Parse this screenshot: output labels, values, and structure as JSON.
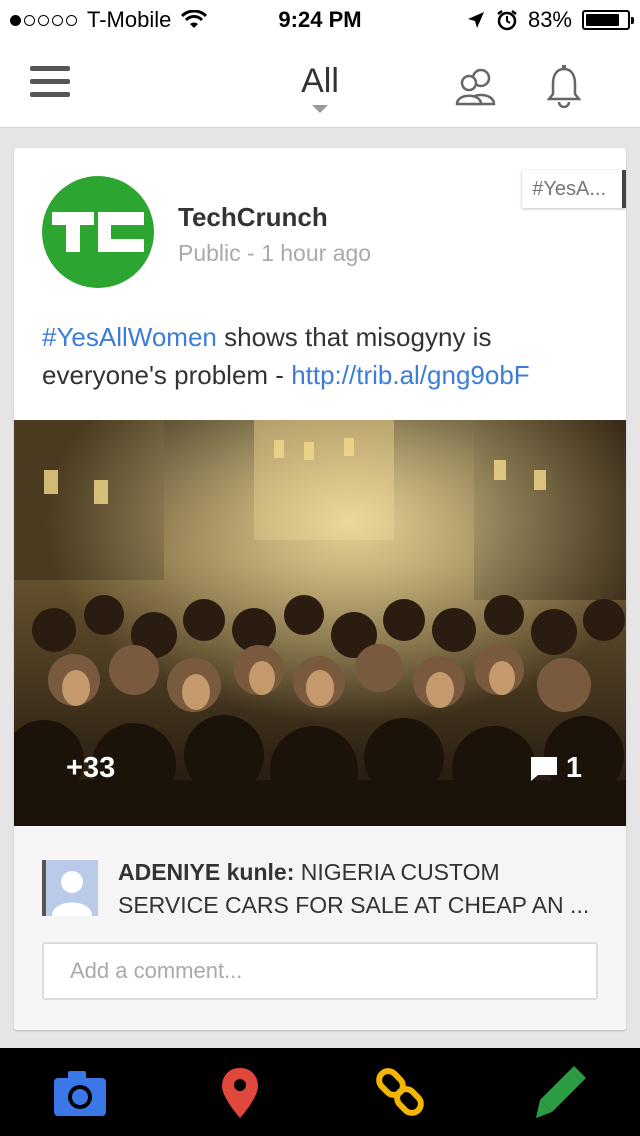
{
  "status_bar": {
    "carrier": "T-Mobile",
    "time": "9:24 PM",
    "battery": "83%",
    "battery_level": 0.83,
    "signal_bars": 1
  },
  "header": {
    "stream_label": "All"
  },
  "post": {
    "tag": "#YesA...",
    "author": "TechCrunch",
    "avatar_text": "TC",
    "meta": "Public - 1 hour ago",
    "hashtag": "#YesAllWomen",
    "text": " shows that misogyny is everyone's problem - ",
    "link": "http://trib.al/gng9obF",
    "plus_count": "+33",
    "comment_count": "1"
  },
  "comment": {
    "author": "ADENIYE kunle:",
    "text": " NIGERIA CUSTOM SERVICE CARS FOR SALE AT CHEAP AN ..."
  },
  "comment_input": {
    "placeholder": "Add a comment..."
  },
  "colors": {
    "link": "#3b7dd8",
    "avatar_green": "#2da531",
    "camera_blue": "#3b78e7",
    "location_red": "#e0483e",
    "link_yellow": "#f4b400",
    "pencil_green": "#2d9d44"
  }
}
